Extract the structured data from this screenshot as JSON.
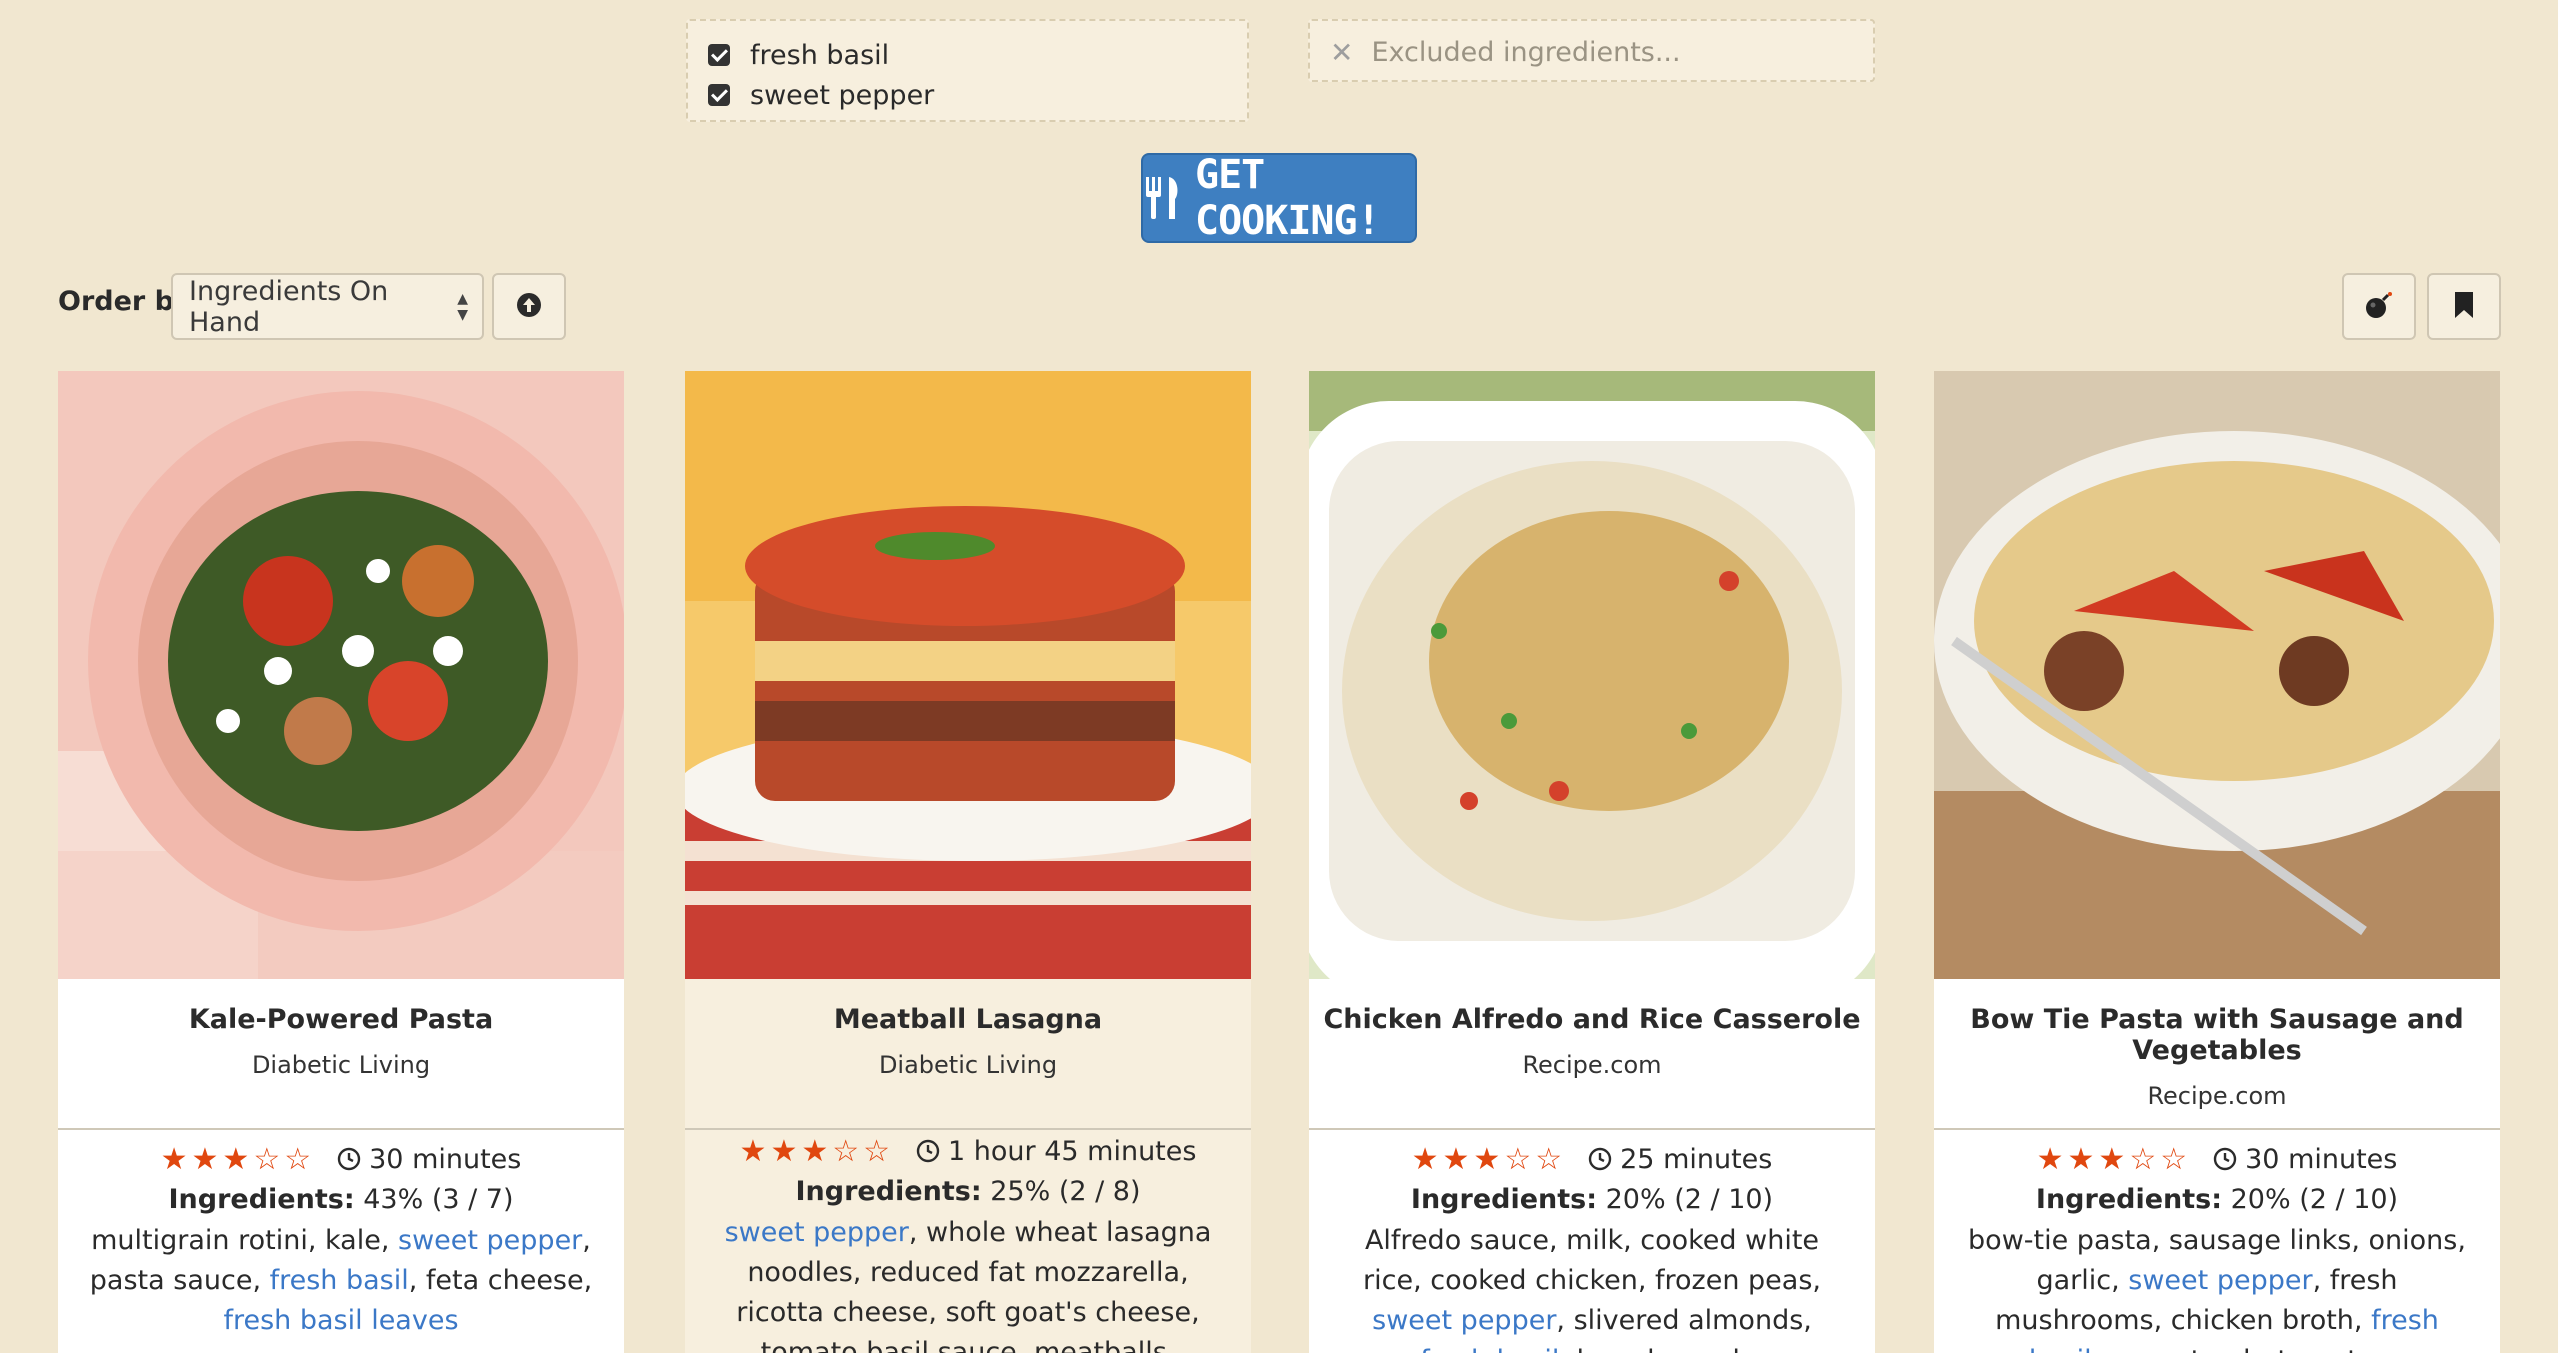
{
  "included_ingredients": [
    "fresh basil",
    "sweet pepper"
  ],
  "excluded": {
    "placeholder": "Excluded ingredients..."
  },
  "get_cooking_label": "GET COOKING!",
  "order": {
    "label": "Order by",
    "selected": "Ingredients On Hand"
  },
  "colors": {
    "accent": "#3e7fc1",
    "star": "#e0470f",
    "link": "#3b78c7",
    "background": "#f1e7d0"
  },
  "recipes": [
    {
      "title": "Kale-Powered Pasta",
      "source": "Diabetic Living",
      "rating": 3,
      "time": "30 minutes",
      "ing_label": "Ingredients:",
      "ing_value": "43% (3 / 7)",
      "ingredients": [
        {
          "t": "multigrain rotini, kale, ",
          "h": false
        },
        {
          "t": "sweet pepper",
          "h": true
        },
        {
          "t": ", pasta sauce, ",
          "h": false
        },
        {
          "t": "fresh basil",
          "h": true
        },
        {
          "t": ", feta cheese, ",
          "h": false
        },
        {
          "t": "fresh basil leaves",
          "h": true
        }
      ]
    },
    {
      "title": "Meatball Lasagna",
      "source": "Diabetic Living",
      "rating": 3,
      "time": "1 hour 45 minutes",
      "ing_label": "Ingredients:",
      "ing_value": "25% (2 / 8)",
      "ingredients": [
        {
          "t": "sweet pepper",
          "h": true
        },
        {
          "t": ", whole wheat lasagna noodles, reduced fat mozzarella, ricotta cheese, soft goat's cheese, tomato basil sauce, meatballs,",
          "h": false
        }
      ]
    },
    {
      "title": "Chicken Alfredo and Rice Casserole",
      "source": "Recipe.com",
      "rating": 3,
      "time": "25 minutes",
      "ing_label": "Ingredients:",
      "ing_value": "20% (2 / 10)",
      "ingredients": [
        {
          "t": "Alfredo sauce, milk, cooked white rice, cooked chicken, frozen peas, ",
          "h": false
        },
        {
          "t": "sweet pepper",
          "h": true
        },
        {
          "t": ", slivered almonds, ",
          "h": false
        },
        {
          "t": "fresh basil",
          "h": true
        },
        {
          "t": ", bread crumbs",
          "h": false
        }
      ]
    },
    {
      "title": "Bow Tie Pasta with Sausage and Vegetables",
      "source": "Recipe.com",
      "rating": 3,
      "time": "30 minutes",
      "ing_label": "Ingredients:",
      "ing_value": "20% (2 / 10)",
      "ingredients": [
        {
          "t": "bow-tie pasta, sausage links, onions, garlic, ",
          "h": false
        },
        {
          "t": "sweet pepper",
          "h": true
        },
        {
          "t": ", fresh mushrooms, chicken broth, ",
          "h": false
        },
        {
          "t": "fresh basil",
          "h": true
        },
        {
          "t": ", corn starch, tomatoes",
          "h": false
        }
      ]
    }
  ]
}
